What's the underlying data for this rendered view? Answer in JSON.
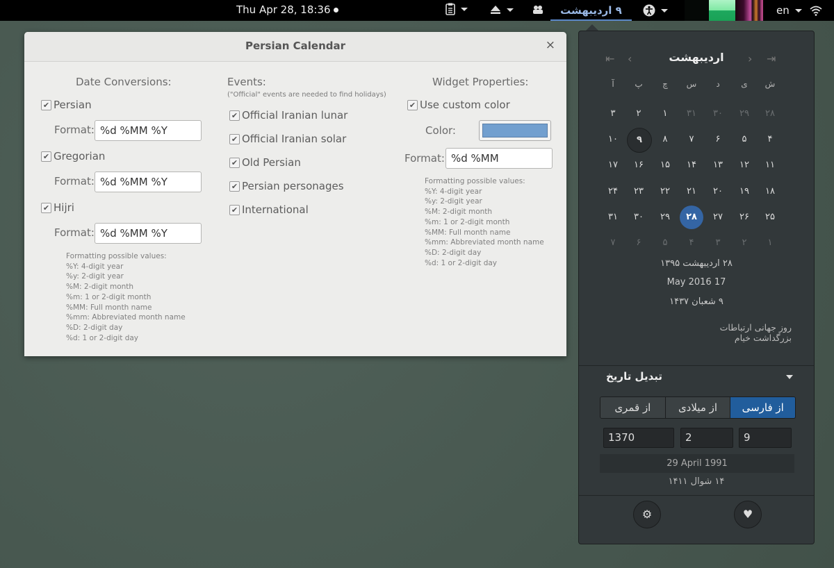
{
  "topbar": {
    "clock": "Thu Apr 28, 18:36",
    "persian_date": "۹ اردیبهشت",
    "language": "en"
  },
  "dialog": {
    "title": "Persian Calendar",
    "close": "×",
    "conversions": {
      "title": "Date Conversions:",
      "items": [
        {
          "label": "Persian",
          "checked": true,
          "format_label": "Format:",
          "format": "%d %MM %Y"
        },
        {
          "label": "Gregorian",
          "checked": true,
          "format_label": "Format:",
          "format": "%d %MM %Y"
        },
        {
          "label": "Hijri",
          "checked": true,
          "format_label": "Format:",
          "format": "%d %MM %Y"
        }
      ],
      "help": [
        "Formatting possible values:",
        "%Y: 4-digit year",
        "%y: 2-digit year",
        "%M: 2-digit month",
        "%m: 1 or 2-digit month",
        "%MM: Full month name",
        "%mm: Abbreviated month name",
        "%D: 2-digit day",
        "%d: 1 or 2-digit day"
      ]
    },
    "events": {
      "title": "Events:",
      "subtitle": "(\"Official\" events are needed to find holidays)",
      "items": [
        "Official Iranian lunar",
        "Official Iranian solar",
        "Old Persian",
        "Persian personages",
        "International"
      ]
    },
    "widget": {
      "title": "Widget Properties:",
      "custom_color_label": "Use custom color",
      "color_label": "Color:",
      "color_value": "#729fcf",
      "format_label": "Format:",
      "format": "%d %MM",
      "help": [
        "Formatting possible values:",
        "%Y: 4-digit year",
        "%y: 2-digit year",
        "%M: 2-digit month",
        "%m: 1 or 2-digit month",
        "%MM: Full month name",
        "%mm: Abbreviated month name",
        "%D: 2-digit day",
        "%d: 1 or 2-digit day"
      ]
    }
  },
  "calendar": {
    "month": "اردیبهشت",
    "weekdays": [
      "ش",
      "ی",
      "د",
      "س",
      "چ",
      "پ",
      "آ"
    ],
    "weeks": [
      [
        "۲۸",
        "۲۹",
        "۳۰",
        "۳۱",
        "۱",
        "۲",
        "۳"
      ],
      [
        "۴",
        "۵",
        "۶",
        "۷",
        "۸",
        "۹",
        "۱۰"
      ],
      [
        "۱۱",
        "۱۲",
        "۱۳",
        "۱۴",
        "۱۵",
        "۱۶",
        "۱۷"
      ],
      [
        "۱۸",
        "۱۹",
        "۲۰",
        "۲۱",
        "۲۲",
        "۲۳",
        "۲۴"
      ],
      [
        "۲۵",
        "۲۶",
        "۲۷",
        "۲۸",
        "۲۹",
        "۳۰",
        "۳۱"
      ],
      [
        "۱",
        "۲",
        "۳",
        "۴",
        "۵",
        "۶",
        "۷"
      ]
    ],
    "info_persian": "۲۸ اردیبهشت ۱۳۹۵",
    "info_gregorian": "17 May 2016",
    "info_hijri": "۹ شعبان ۱۴۳۷",
    "events": [
      "روز جهانی ارتباطات",
      "بزرگداشت خیام"
    ],
    "converter_title": "تبدیل تاریخ",
    "tabs": [
      "از قمری",
      "از میلادی",
      "از فارسی"
    ],
    "fields": [
      "1370",
      "2",
      "9"
    ],
    "result_gregorian": "29 April 1991",
    "result_hijri": "۱۴ شوال ۱۴۱۱"
  }
}
